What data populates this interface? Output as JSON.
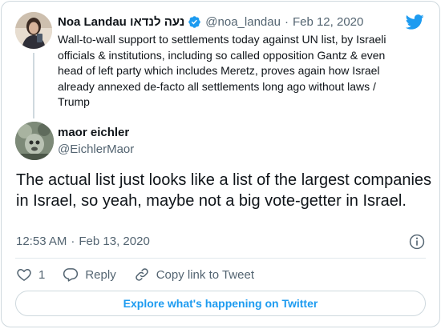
{
  "parent_tweet": {
    "author_name": "Noa Landau נעה לנדאו",
    "handle": "@noa_landau",
    "separator": "·",
    "date": "Feb 12, 2020",
    "text": "Wall-to-wall support to settlements today against UN list, by Israeli officials & institutions, including so called opposition Gantz & even head of left party which includes Meretz, proves again how Israel already annexed de-facto all settlements long ago without laws / Trump"
  },
  "main_tweet": {
    "author_name": "maor eichler",
    "handle": "@EichlerMaor",
    "text": "The actual list just looks like a list of the largest companies in Israel, so yeah, maybe not a big vote-getter in Israel.",
    "time": "12:53 AM",
    "separator": "·",
    "date": "Feb 13, 2020"
  },
  "actions": {
    "like_count": "1",
    "reply_label": "Reply",
    "copy_link_label": "Copy link to Tweet"
  },
  "explore_label": "Explore what's happening on Twitter",
  "colors": {
    "brand": "#1d9bf0",
    "text": "#0f1419",
    "muted": "#536471",
    "border": "#cfd9de"
  },
  "icons": [
    "twitter-bird-icon",
    "verified-badge-icon",
    "info-icon",
    "heart-icon",
    "reply-icon",
    "link-icon"
  ]
}
